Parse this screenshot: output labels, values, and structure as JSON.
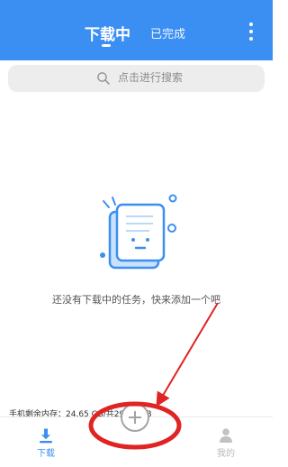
{
  "header": {
    "tab_downloading": "下载中",
    "tab_completed": "已完成",
    "more_icon": "more-vertical-icon"
  },
  "search": {
    "placeholder": "点击进行搜索",
    "icon": "search-icon"
  },
  "empty_state": {
    "message": "还没有下载中的任务，快来添加一个吧",
    "illustration": "empty-document-icon"
  },
  "storage": {
    "text": "手机剩余内存：24.65 GB/共29.23 GB"
  },
  "bottom_nav": {
    "download_label": "下载",
    "mine_label": "我的",
    "download_icon": "download-icon",
    "mine_icon": "person-icon",
    "add_icon": "plus-circle-icon"
  },
  "colors": {
    "primary": "#3b8ff3",
    "annotation": "#e02323",
    "inactive": "#b9b9b9"
  }
}
